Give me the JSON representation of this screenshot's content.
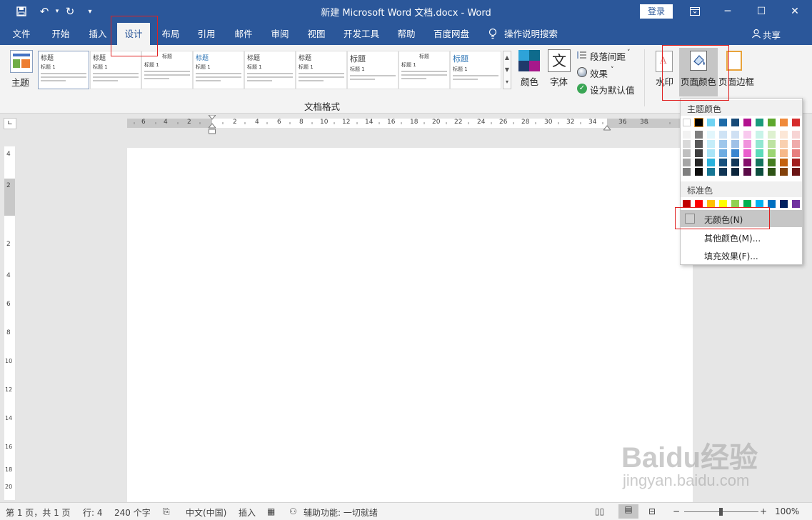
{
  "titlebar": {
    "doc_title": "新建 Microsoft Word 文档.docx - Word",
    "login": "登录",
    "icons": [
      "save-icon",
      "undo-icon",
      "redo-icon",
      "customize-icon"
    ]
  },
  "tabs": [
    "文件",
    "开始",
    "插入",
    "设计",
    "布局",
    "引用",
    "邮件",
    "审阅",
    "视图",
    "开发工具",
    "帮助",
    "百度网盘"
  ],
  "active_tab": "设计",
  "tell_me": "操作说明搜索",
  "share": "共享",
  "ribbon": {
    "themes_label": "主题",
    "thumb_heading": "标题",
    "thumb_sub": "标题 1",
    "group_label": "文档格式",
    "colors_label": "颜色",
    "fonts_label": "字体",
    "paragraph_spacing": "段落间距",
    "effects": "效果",
    "set_default": "设为默认值",
    "watermark": "水印",
    "page_color": "页面颜色",
    "page_borders": "页面边框"
  },
  "ruler_h": [
    "6",
    "4",
    "2",
    "2",
    "4",
    "6",
    "8",
    "10",
    "12",
    "14",
    "16",
    "18",
    "20",
    "22",
    "24",
    "26",
    "28",
    "30",
    "32",
    "34",
    "36",
    "38"
  ],
  "ruler_v": [
    "4",
    "2",
    "2",
    "4",
    "6",
    "8",
    "10",
    "12",
    "14",
    "16",
    "18",
    "20",
    "22"
  ],
  "dropdown": {
    "theme_header": "主题颜色",
    "standard_header": "标准色",
    "no_color": "无颜色(N)",
    "more_colors": "其他颜色(M)...",
    "fill_effects": "填充效果(F)...",
    "theme_top": [
      "#ffffff",
      "#000000",
      "#e7e6e6",
      "#44546a",
      "#4472c4",
      "#ed7d31",
      "#a5a5a5",
      "#ffc000",
      "#5b9bd5",
      "#70ad47"
    ],
    "standard": [
      "#c00000",
      "#ff0000",
      "#ffc000",
      "#ffff00",
      "#92d050",
      "#00b050",
      "#00b0f0",
      "#0070c0",
      "#002060",
      "#7030a0"
    ]
  },
  "status": {
    "page": "第 1 页，共 1 页",
    "line": "行: 4",
    "words": "240 个字",
    "lang": "中文(中国)",
    "insert": "插入",
    "accessibility": "辅助功能: 一切就绪",
    "zoom": "100%"
  },
  "watermark": {
    "brand": "Baidu经验",
    "url": "jingyan.baidu.com"
  }
}
